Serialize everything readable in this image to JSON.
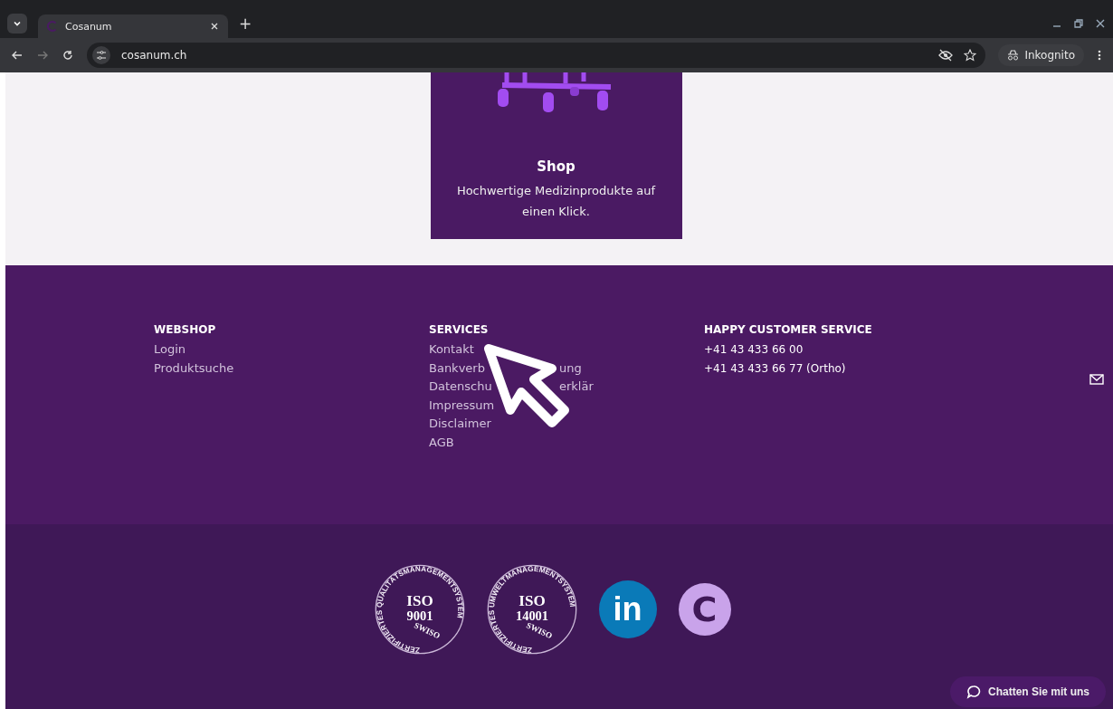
{
  "browser": {
    "tab_title": "Cosanum",
    "new_tab": "+",
    "url": "cosanum.ch",
    "profile": "Inkognito"
  },
  "shop_card": {
    "title": "Shop",
    "text": "Hochwertige Medizinprodukte auf einen Klick."
  },
  "footer_columns": [
    {
      "heading": "WEBSHOP",
      "links": [
        "Login",
        "Produktsuche"
      ]
    },
    {
      "heading": "SERVICES",
      "links": [
        "Kontakt",
        [
          "Bankverb",
          "ung"
        ],
        [
          "Datenschu",
          "erklär"
        ],
        "Impressum",
        "Disclaimer",
        "AGB"
      ]
    },
    {
      "heading": "HAPPY CUSTOMER SERVICE",
      "links": [
        "+41 43 433 66 00",
        "+41 43 433 66 77 (Ortho)"
      ]
    }
  ],
  "badges": [
    {
      "kind": "iso",
      "line1": "ISO",
      "line2": "9001",
      "ring": "ZERTIFIZIERTES QUALITÄTSMANAGEMENTSYSTEM",
      "mark": "SWISO"
    },
    {
      "kind": "iso",
      "line1": "ISO",
      "line2": "14001",
      "ring": "ZERTIFIZIERTES UMWELTMANAGEMENTSYSTEM",
      "mark": "SWISO"
    },
    {
      "kind": "linkedin",
      "label": "in"
    },
    {
      "kind": "cookie",
      "label": "C"
    }
  ],
  "chat_button": "Chatten Sie mit uns"
}
